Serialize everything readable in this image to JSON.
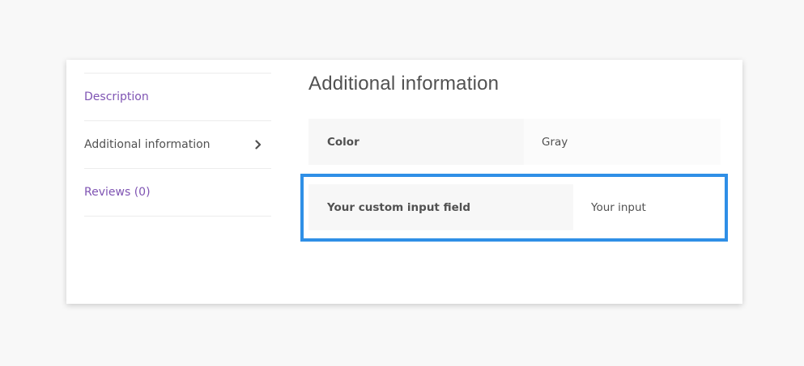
{
  "tabs": [
    {
      "label": "Description",
      "active": false
    },
    {
      "label": "Additional information",
      "active": true
    },
    {
      "label": "Reviews (0)",
      "active": false
    }
  ],
  "panel": {
    "title": "Additional information",
    "attributes": [
      {
        "label": "Color",
        "value": "Gray"
      },
      {
        "label": "Your custom input field",
        "value": "Your input"
      }
    ]
  },
  "icons": {
    "active_tab_indicator": "chevron-right-icon"
  },
  "colors": {
    "link": "#7f54b3",
    "text": "#515151",
    "highlight": "#2f8fe6",
    "page_background": "#f8f8f8"
  }
}
